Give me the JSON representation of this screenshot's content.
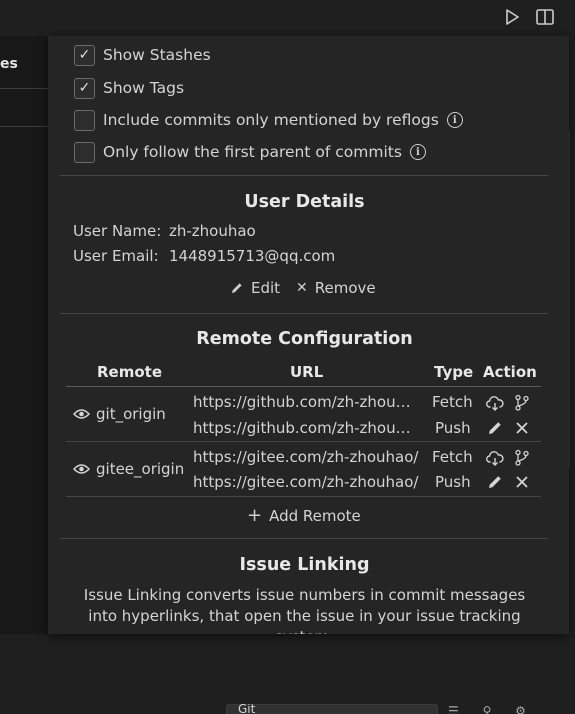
{
  "background": {
    "left_panel_label": "es",
    "status_select_label": "Git"
  },
  "options": [
    {
      "label": "Show Stashes",
      "checked": true
    },
    {
      "label": "Show Tags",
      "checked": true
    },
    {
      "label": "Include commits only mentioned by reflogs",
      "checked": false,
      "info": true
    },
    {
      "label": "Only follow the first parent of commits",
      "checked": false,
      "info": true
    }
  ],
  "user_details": {
    "title": "User Details",
    "name_label": "User Name:",
    "name_value": "zh-zhouhao",
    "email_label": "User Email:",
    "email_value": "1448915713@qq.com",
    "edit_label": "Edit",
    "remove_label": "Remove"
  },
  "remote_config": {
    "title": "Remote Configuration",
    "headers": {
      "remote": "Remote",
      "url": "URL",
      "type": "Type",
      "action": "Action"
    },
    "remotes": [
      {
        "name": "git_origin",
        "fetch_url": "https://github.com/zh-zhouhao/",
        "fetch_type": "Fetch",
        "push_url": "https://github.com/zh-zhouhao/",
        "push_type": "Push"
      },
      {
        "name": "gitee_origin",
        "fetch_url": "https://gitee.com/zh-zhouhao/",
        "fetch_type": "Fetch",
        "push_url": "https://gitee.com/zh-zhouhao/",
        "push_type": "Push"
      }
    ],
    "add_remote_label": "Add Remote"
  },
  "issue_linking": {
    "title": "Issue Linking",
    "description": "Issue Linking converts issue numbers in commit messages into hyperlinks, that open the issue in your issue tracking system."
  },
  "colors": {
    "dialog_bg": "#252526",
    "editor_bg": "#1f1f1f",
    "text": "#d4d4d4",
    "divider": "#454545"
  }
}
